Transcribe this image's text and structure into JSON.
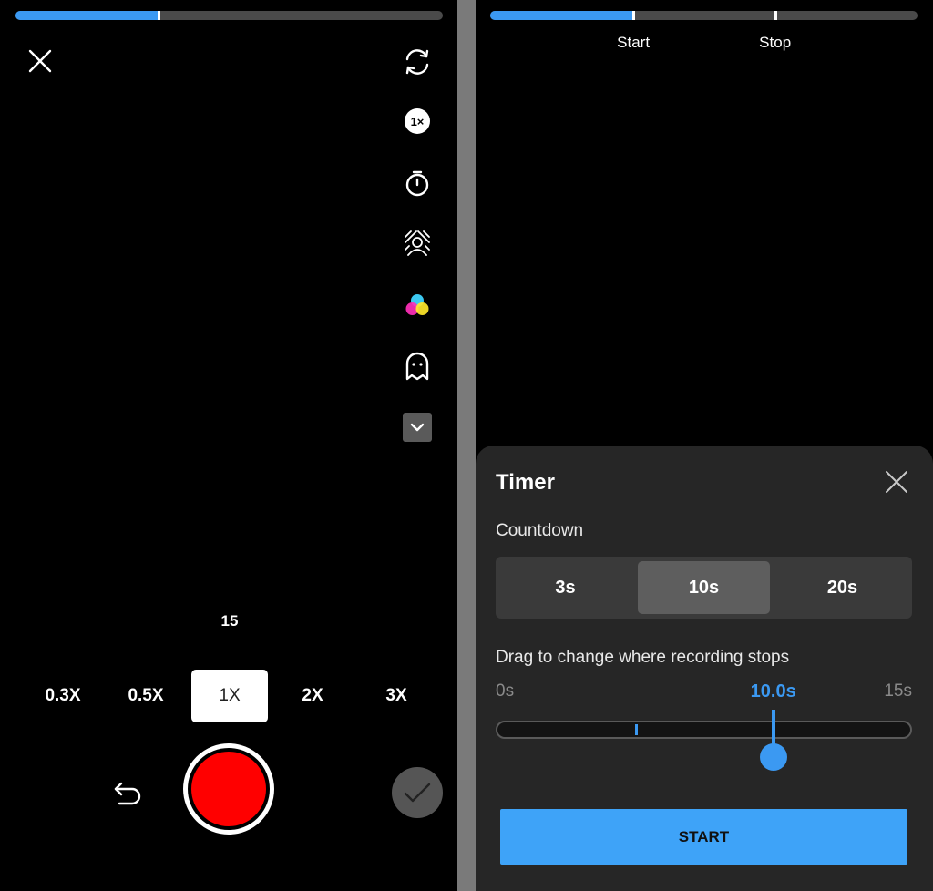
{
  "camera": {
    "progress_fraction": 0.335,
    "icons": [
      "close-icon",
      "flip-camera-icon",
      "speed-icon",
      "timer-icon",
      "beauty-icon",
      "filters-icon",
      "ghost-icon",
      "chevron-down-icon",
      "undo-icon",
      "checkmark-icon"
    ],
    "speed_badge": "1×",
    "duration": "15",
    "speeds": [
      {
        "label": "0.3X",
        "active": false
      },
      {
        "label": "0.5X",
        "active": false
      },
      {
        "label": "1X",
        "active": true
      },
      {
        "label": "2X",
        "active": false
      },
      {
        "label": "3X",
        "active": false
      }
    ]
  },
  "timer": {
    "progress_fraction": 0.335,
    "stop_fraction": 0.6667,
    "markers": {
      "start": "Start",
      "stop": "Stop"
    },
    "title": "Timer",
    "countdown_label": "Countdown",
    "countdown_options": [
      {
        "label": "3s",
        "active": false
      },
      {
        "label": "10s",
        "active": true
      },
      {
        "label": "20s",
        "active": false
      }
    ],
    "drag_label": "Drag to change where recording stops",
    "range_min": "0s",
    "range_max": "15s",
    "range_current": "10.0s",
    "start_label": "START"
  },
  "colors": {
    "accent": "#3b99f2",
    "record": "#ff0000",
    "sheet": "#262626"
  }
}
